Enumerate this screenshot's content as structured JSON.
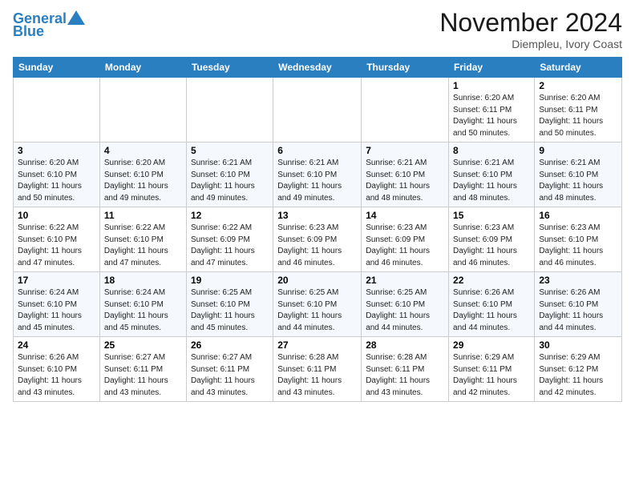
{
  "header": {
    "logo_line1": "General",
    "logo_line2": "Blue",
    "month": "November 2024",
    "location": "Diempleu, Ivory Coast"
  },
  "weekdays": [
    "Sunday",
    "Monday",
    "Tuesday",
    "Wednesday",
    "Thursday",
    "Friday",
    "Saturday"
  ],
  "weeks": [
    [
      {
        "day": "",
        "info": ""
      },
      {
        "day": "",
        "info": ""
      },
      {
        "day": "",
        "info": ""
      },
      {
        "day": "",
        "info": ""
      },
      {
        "day": "",
        "info": ""
      },
      {
        "day": "1",
        "info": "Sunrise: 6:20 AM\nSunset: 6:11 PM\nDaylight: 11 hours\nand 50 minutes."
      },
      {
        "day": "2",
        "info": "Sunrise: 6:20 AM\nSunset: 6:11 PM\nDaylight: 11 hours\nand 50 minutes."
      }
    ],
    [
      {
        "day": "3",
        "info": "Sunrise: 6:20 AM\nSunset: 6:10 PM\nDaylight: 11 hours\nand 50 minutes."
      },
      {
        "day": "4",
        "info": "Sunrise: 6:20 AM\nSunset: 6:10 PM\nDaylight: 11 hours\nand 49 minutes."
      },
      {
        "day": "5",
        "info": "Sunrise: 6:21 AM\nSunset: 6:10 PM\nDaylight: 11 hours\nand 49 minutes."
      },
      {
        "day": "6",
        "info": "Sunrise: 6:21 AM\nSunset: 6:10 PM\nDaylight: 11 hours\nand 49 minutes."
      },
      {
        "day": "7",
        "info": "Sunrise: 6:21 AM\nSunset: 6:10 PM\nDaylight: 11 hours\nand 48 minutes."
      },
      {
        "day": "8",
        "info": "Sunrise: 6:21 AM\nSunset: 6:10 PM\nDaylight: 11 hours\nand 48 minutes."
      },
      {
        "day": "9",
        "info": "Sunrise: 6:21 AM\nSunset: 6:10 PM\nDaylight: 11 hours\nand 48 minutes."
      }
    ],
    [
      {
        "day": "10",
        "info": "Sunrise: 6:22 AM\nSunset: 6:10 PM\nDaylight: 11 hours\nand 47 minutes."
      },
      {
        "day": "11",
        "info": "Sunrise: 6:22 AM\nSunset: 6:10 PM\nDaylight: 11 hours\nand 47 minutes."
      },
      {
        "day": "12",
        "info": "Sunrise: 6:22 AM\nSunset: 6:09 PM\nDaylight: 11 hours\nand 47 minutes."
      },
      {
        "day": "13",
        "info": "Sunrise: 6:23 AM\nSunset: 6:09 PM\nDaylight: 11 hours\nand 46 minutes."
      },
      {
        "day": "14",
        "info": "Sunrise: 6:23 AM\nSunset: 6:09 PM\nDaylight: 11 hours\nand 46 minutes."
      },
      {
        "day": "15",
        "info": "Sunrise: 6:23 AM\nSunset: 6:09 PM\nDaylight: 11 hours\nand 46 minutes."
      },
      {
        "day": "16",
        "info": "Sunrise: 6:23 AM\nSunset: 6:10 PM\nDaylight: 11 hours\nand 46 minutes."
      }
    ],
    [
      {
        "day": "17",
        "info": "Sunrise: 6:24 AM\nSunset: 6:10 PM\nDaylight: 11 hours\nand 45 minutes."
      },
      {
        "day": "18",
        "info": "Sunrise: 6:24 AM\nSunset: 6:10 PM\nDaylight: 11 hours\nand 45 minutes."
      },
      {
        "day": "19",
        "info": "Sunrise: 6:25 AM\nSunset: 6:10 PM\nDaylight: 11 hours\nand 45 minutes."
      },
      {
        "day": "20",
        "info": "Sunrise: 6:25 AM\nSunset: 6:10 PM\nDaylight: 11 hours\nand 44 minutes."
      },
      {
        "day": "21",
        "info": "Sunrise: 6:25 AM\nSunset: 6:10 PM\nDaylight: 11 hours\nand 44 minutes."
      },
      {
        "day": "22",
        "info": "Sunrise: 6:26 AM\nSunset: 6:10 PM\nDaylight: 11 hours\nand 44 minutes."
      },
      {
        "day": "23",
        "info": "Sunrise: 6:26 AM\nSunset: 6:10 PM\nDaylight: 11 hours\nand 44 minutes."
      }
    ],
    [
      {
        "day": "24",
        "info": "Sunrise: 6:26 AM\nSunset: 6:10 PM\nDaylight: 11 hours\nand 43 minutes."
      },
      {
        "day": "25",
        "info": "Sunrise: 6:27 AM\nSunset: 6:11 PM\nDaylight: 11 hours\nand 43 minutes."
      },
      {
        "day": "26",
        "info": "Sunrise: 6:27 AM\nSunset: 6:11 PM\nDaylight: 11 hours\nand 43 minutes."
      },
      {
        "day": "27",
        "info": "Sunrise: 6:28 AM\nSunset: 6:11 PM\nDaylight: 11 hours\nand 43 minutes."
      },
      {
        "day": "28",
        "info": "Sunrise: 6:28 AM\nSunset: 6:11 PM\nDaylight: 11 hours\nand 43 minutes."
      },
      {
        "day": "29",
        "info": "Sunrise: 6:29 AM\nSunset: 6:11 PM\nDaylight: 11 hours\nand 42 minutes."
      },
      {
        "day": "30",
        "info": "Sunrise: 6:29 AM\nSunset: 6:12 PM\nDaylight: 11 hours\nand 42 minutes."
      }
    ]
  ]
}
